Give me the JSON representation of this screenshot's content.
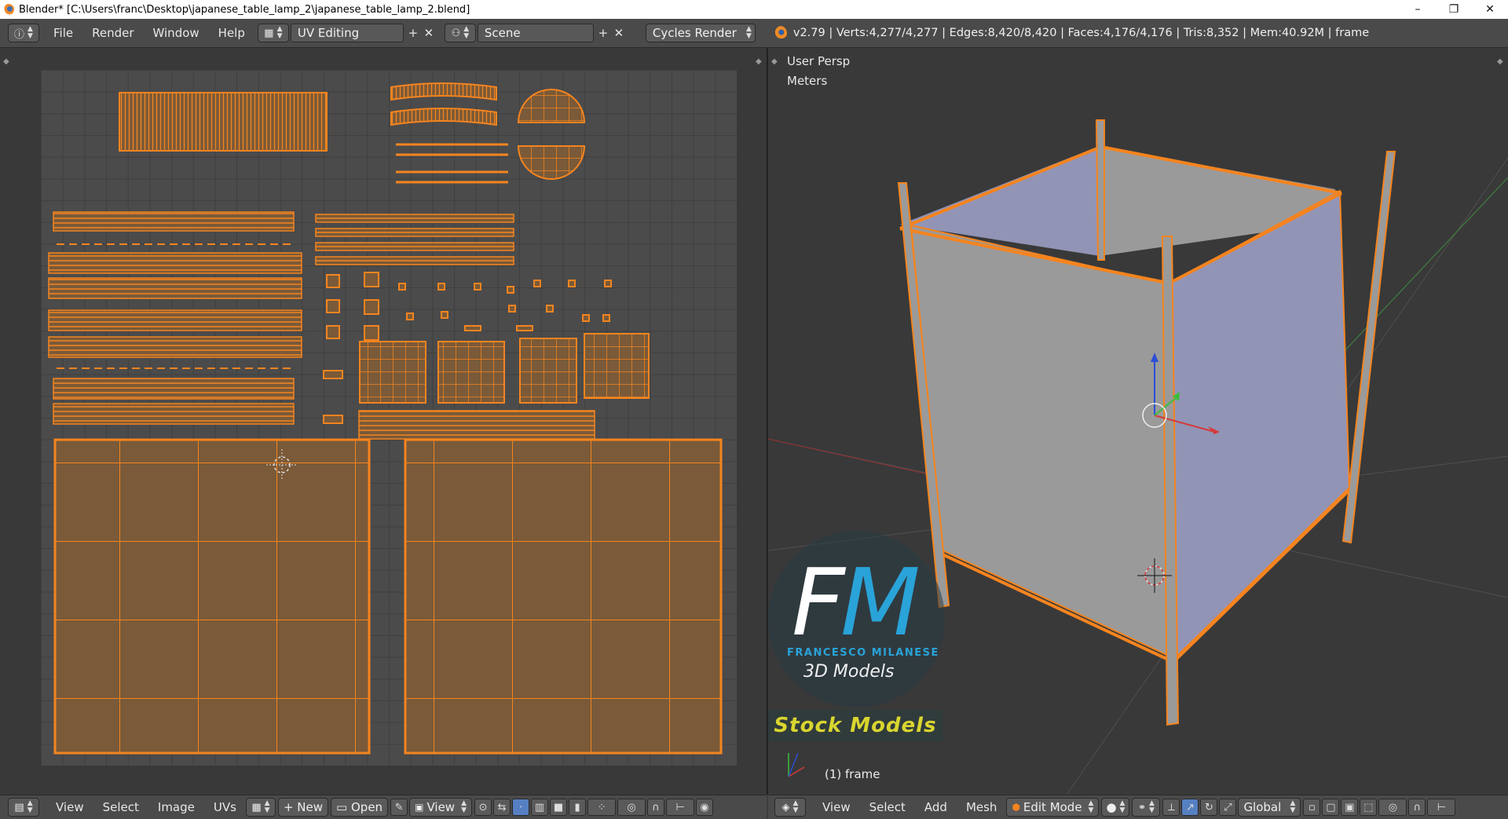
{
  "window": {
    "title": "Blender* [C:\\Users\\franc\\Desktop\\japanese_table_lamp_2\\japanese_table_lamp_2.blend]",
    "controls": {
      "minimize": "–",
      "maximize": "❐",
      "close": "✕"
    }
  },
  "topbar": {
    "menus": [
      "File",
      "Render",
      "Window",
      "Help"
    ],
    "screen_layout": "UV Editing",
    "scene": "Scene",
    "render_engine": "Cycles Render",
    "stats": "v2.79 | Verts:4,277/4,277 | Edges:8,420/8,420 | Faces:4,176/4,176 | Tris:8,352 | Mem:40.92M | frame"
  },
  "uv_editor": {
    "header": {
      "menus": [
        "View",
        "Select",
        "Image",
        "UVs"
      ],
      "new_label": "New",
      "open_label": "Open",
      "view_label": "View"
    }
  },
  "viewport": {
    "view_name": "User Persp",
    "units": "Meters",
    "object_label": "(1) frame",
    "header": {
      "menus": [
        "View",
        "Select",
        "Add",
        "Mesh"
      ],
      "mode": "Edit Mode",
      "orientation": "Global"
    }
  },
  "watermark": {
    "letter_f": "F",
    "letter_m": "M",
    "name": "FRANCESCO MILANESE",
    "sub": "3D Models",
    "stock": "Stock Models"
  },
  "colors": {
    "uv_orange": "#f5841f",
    "face_fill": "#7a5a38",
    "accent_blue": "#5680c2",
    "paper_gray": "#9a9a9a",
    "paper_lavender": "#9294b6"
  }
}
